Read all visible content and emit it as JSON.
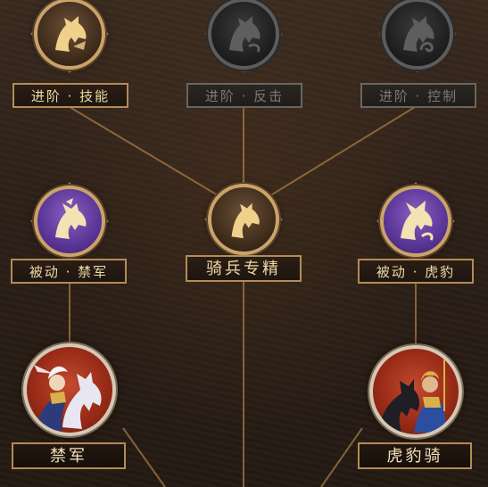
{
  "nodes": {
    "advance_skill": {
      "label": "进阶 · 技能",
      "state": "unlocked",
      "icon": "horse-head-icon"
    },
    "advance_counter": {
      "label": "进阶 · 反击",
      "state": "locked",
      "icon": "horse-head-icon"
    },
    "advance_control": {
      "label": "进阶 · 控制",
      "state": "locked",
      "icon": "horse-head-icon"
    },
    "passive_jinjun": {
      "label": "被动 · 禁军",
      "state": "unlocked",
      "icon": "armored-horse-icon"
    },
    "cavalry_mastery": {
      "label": "骑兵专精",
      "state": "unlocked",
      "icon": "horse-head-icon"
    },
    "passive_hubao": {
      "label": "被动 · 虎豹",
      "state": "unlocked",
      "icon": "tiger-horse-icon"
    },
    "jinjun": {
      "label": "禁军",
      "state": "unlocked",
      "icon": "white-horse-general-portrait"
    },
    "hubaoqi": {
      "label": "虎豹骑",
      "state": "unlocked",
      "icon": "armored-cavalry-portrait"
    }
  },
  "colors": {
    "gold": "#c9a36a",
    "label_text": "#f1d9a6",
    "locked_text": "#7d7873",
    "purple": "#6b45a8",
    "portrait_red": "#b03a22",
    "link_line": "#a67a45"
  }
}
